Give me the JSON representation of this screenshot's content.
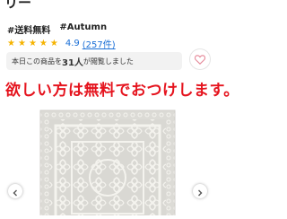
{
  "product": {
    "title_tail": "リー",
    "tags": [
      "#送料無料",
      "#Autumn"
    ],
    "rating_value": "4.9",
    "review_count": "(257件)",
    "stars": [
      "★",
      "★",
      "★",
      "★",
      "★"
    ]
  },
  "viewers": {
    "prefix": "本日この商品を",
    "count": "31人",
    "suffix": "が閲覧しました"
  },
  "banner": {
    "text": "欲しい方は無料でおつけします。"
  },
  "icons": {
    "favorite": "heart-icon",
    "prev": "chevron-left-icon",
    "next": "chevron-right-icon"
  },
  "colors": {
    "star": "#f5b301",
    "link": "#1b6fd6",
    "banner": "#e5141e",
    "rug_base": "#d9d8d3",
    "rug_pattern": "#f4f3ee"
  }
}
